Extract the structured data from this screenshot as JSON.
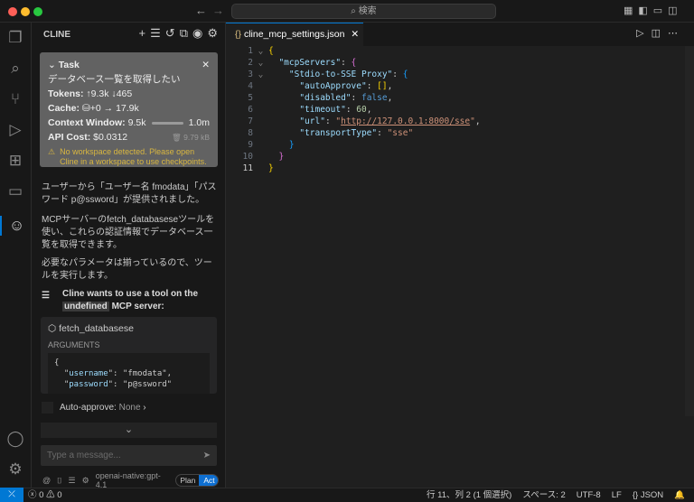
{
  "titlebar": {
    "search_placeholder": "検索"
  },
  "sidebar": {
    "title": "CLINE"
  },
  "task": {
    "header": "Task",
    "title": "データベース一覧を取得したい",
    "tokens_label": "Tokens:",
    "tokens_up": "9.3k",
    "tokens_down": "465",
    "cache_label": "Cache:",
    "cache_write": "+0",
    "cache_read": "17.9k",
    "context_label": "Context Window:",
    "context_used": "9.5k",
    "context_max": "1.0m",
    "context_fraction": 0.0095,
    "cost_label": "API Cost:",
    "cost": "$0.0312",
    "size": "9.79 kB",
    "warning": "No workspace detected. Please open Cline in a workspace to use checkpoints."
  },
  "messages": [
    "ユーザーから「ユーザー名 fmodata」「パスワード p@ssword」が提供されました。",
    "MCPサーバーのfetch_databaseseツールを使い、これらの認証情報でデータベース一覧を取得できます。",
    "必要なパラメータは揃っているので、ツールを実行します。"
  ],
  "tool_request": {
    "prefix": "Cline wants to use a tool on the",
    "server": "undefined",
    "suffix": "MCP server:",
    "tool_name": "fetch_databasese",
    "arguments_label": "ARGUMENTS",
    "args": [
      {
        "key": "username",
        "value": "fmodata"
      },
      {
        "key": "password",
        "value": "p@ssword"
      }
    ]
  },
  "auto_approve": {
    "label": "Auto-approve:",
    "value": "None"
  },
  "input": {
    "placeholder": "Type a message...",
    "model": "openai-native:gpt-4.1",
    "plan": "Plan",
    "act": "Act"
  },
  "editor": {
    "tab": "cline_mcp_settings.json"
  },
  "status": {
    "errors": "0",
    "warnings": "0",
    "position": "行 11、列 2 (1 個選択)",
    "spaces": "スペース: 2",
    "encoding": "UTF-8",
    "eol": "LF",
    "language": "JSON"
  }
}
